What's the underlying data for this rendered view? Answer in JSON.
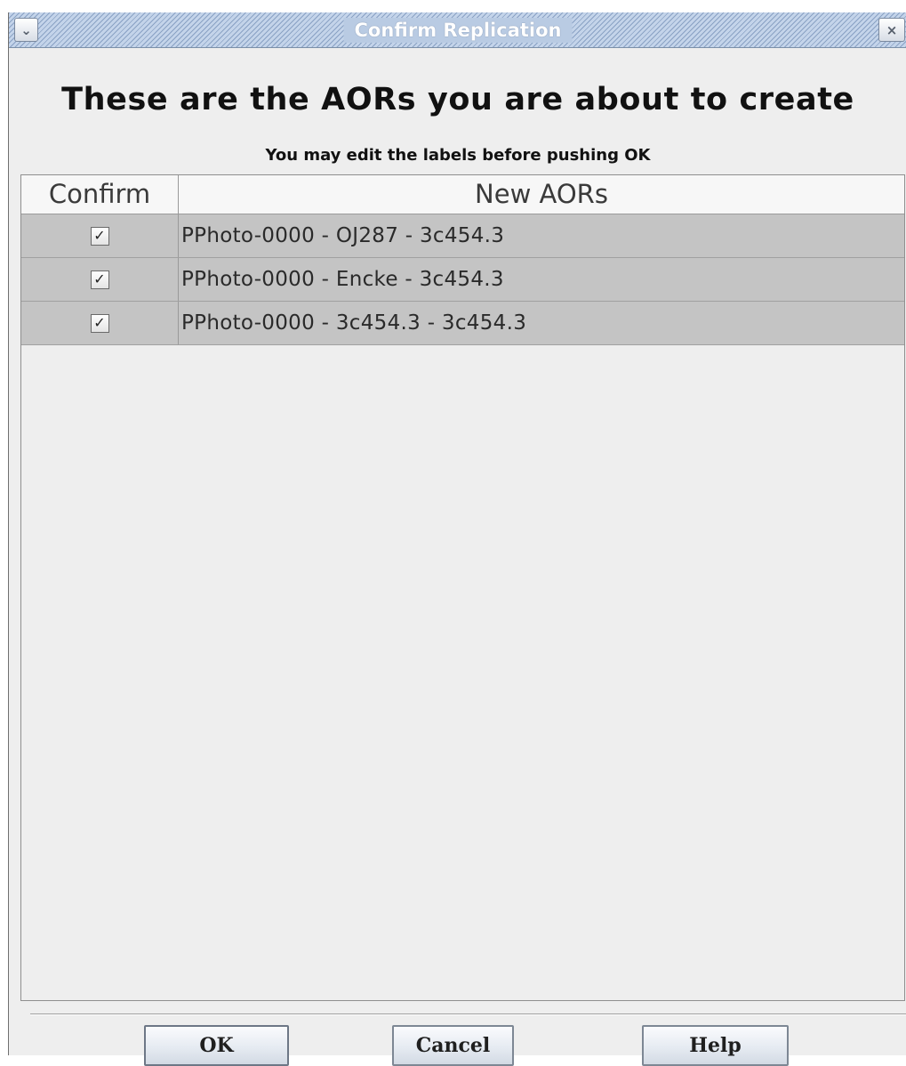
{
  "window": {
    "title": "Confirm Replication",
    "menu_icon": "chevron-down-icon",
    "close_icon": "close-icon"
  },
  "header": {
    "title": "These are the AORs you are about to create",
    "subtitle": "You may edit the labels before pushing OK"
  },
  "table": {
    "columns": [
      "Confirm",
      "New AORs"
    ],
    "rows": [
      {
        "confirmed": true,
        "label": "PPhoto-0000 - OJ287 - 3c454.3"
      },
      {
        "confirmed": true,
        "label": "PPhoto-0000 - Encke - 3c454.3"
      },
      {
        "confirmed": true,
        "label": "PPhoto-0000 - 3c454.3 - 3c454.3"
      }
    ]
  },
  "buttons": {
    "ok": "OK",
    "cancel": "Cancel",
    "help": "Help"
  },
  "colors": {
    "titlebar": "#b6c8e0",
    "row_background": "#c4c4c4",
    "dialog_background": "#eeeeee"
  }
}
